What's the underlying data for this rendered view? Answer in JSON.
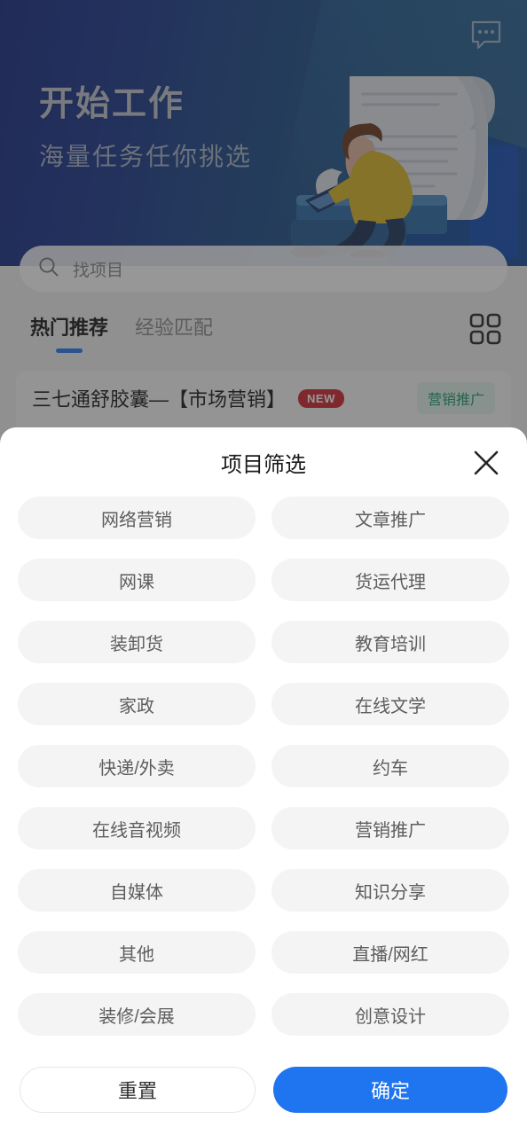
{
  "hero": {
    "title": "开始工作",
    "subtitle": "海量任务任你挑选",
    "chat_icon": "chat-bubble-icon",
    "illustration": "person-with-laptop-and-scroll-illustration",
    "gradient_from": "#1e2f85",
    "gradient_to": "#2e6089"
  },
  "search": {
    "placeholder": "找项目",
    "value": "",
    "icon": "search-icon"
  },
  "tabs": [
    {
      "label": "热门推荐",
      "active": true
    },
    {
      "label": "经验匹配",
      "active": false
    }
  ],
  "grid_toggle": {
    "icon": "grid-view-icon"
  },
  "list": {
    "items": [
      {
        "title": "三七通舒胶囊—【市场营销】",
        "badge": "NEW",
        "tag": "营销推广",
        "badge_color": "#cf2b36",
        "tag_color": "#1f9e6b"
      }
    ]
  },
  "modal": {
    "title": "项目筛选",
    "close_icon": "close-icon",
    "chips": [
      "网络营销",
      "文章推广",
      "网课",
      "货运代理",
      "装卸货",
      "教育培训",
      "家政",
      "在线文学",
      "快递/外卖",
      "约车",
      "在线音视频",
      "营销推广",
      "自媒体",
      "知识分享",
      "其他",
      "直播/网红",
      "装修/会展",
      "创意设计"
    ],
    "footer": {
      "reset_label": "重置",
      "confirm_label": "确定",
      "confirm_color": "#1f74f0"
    }
  }
}
